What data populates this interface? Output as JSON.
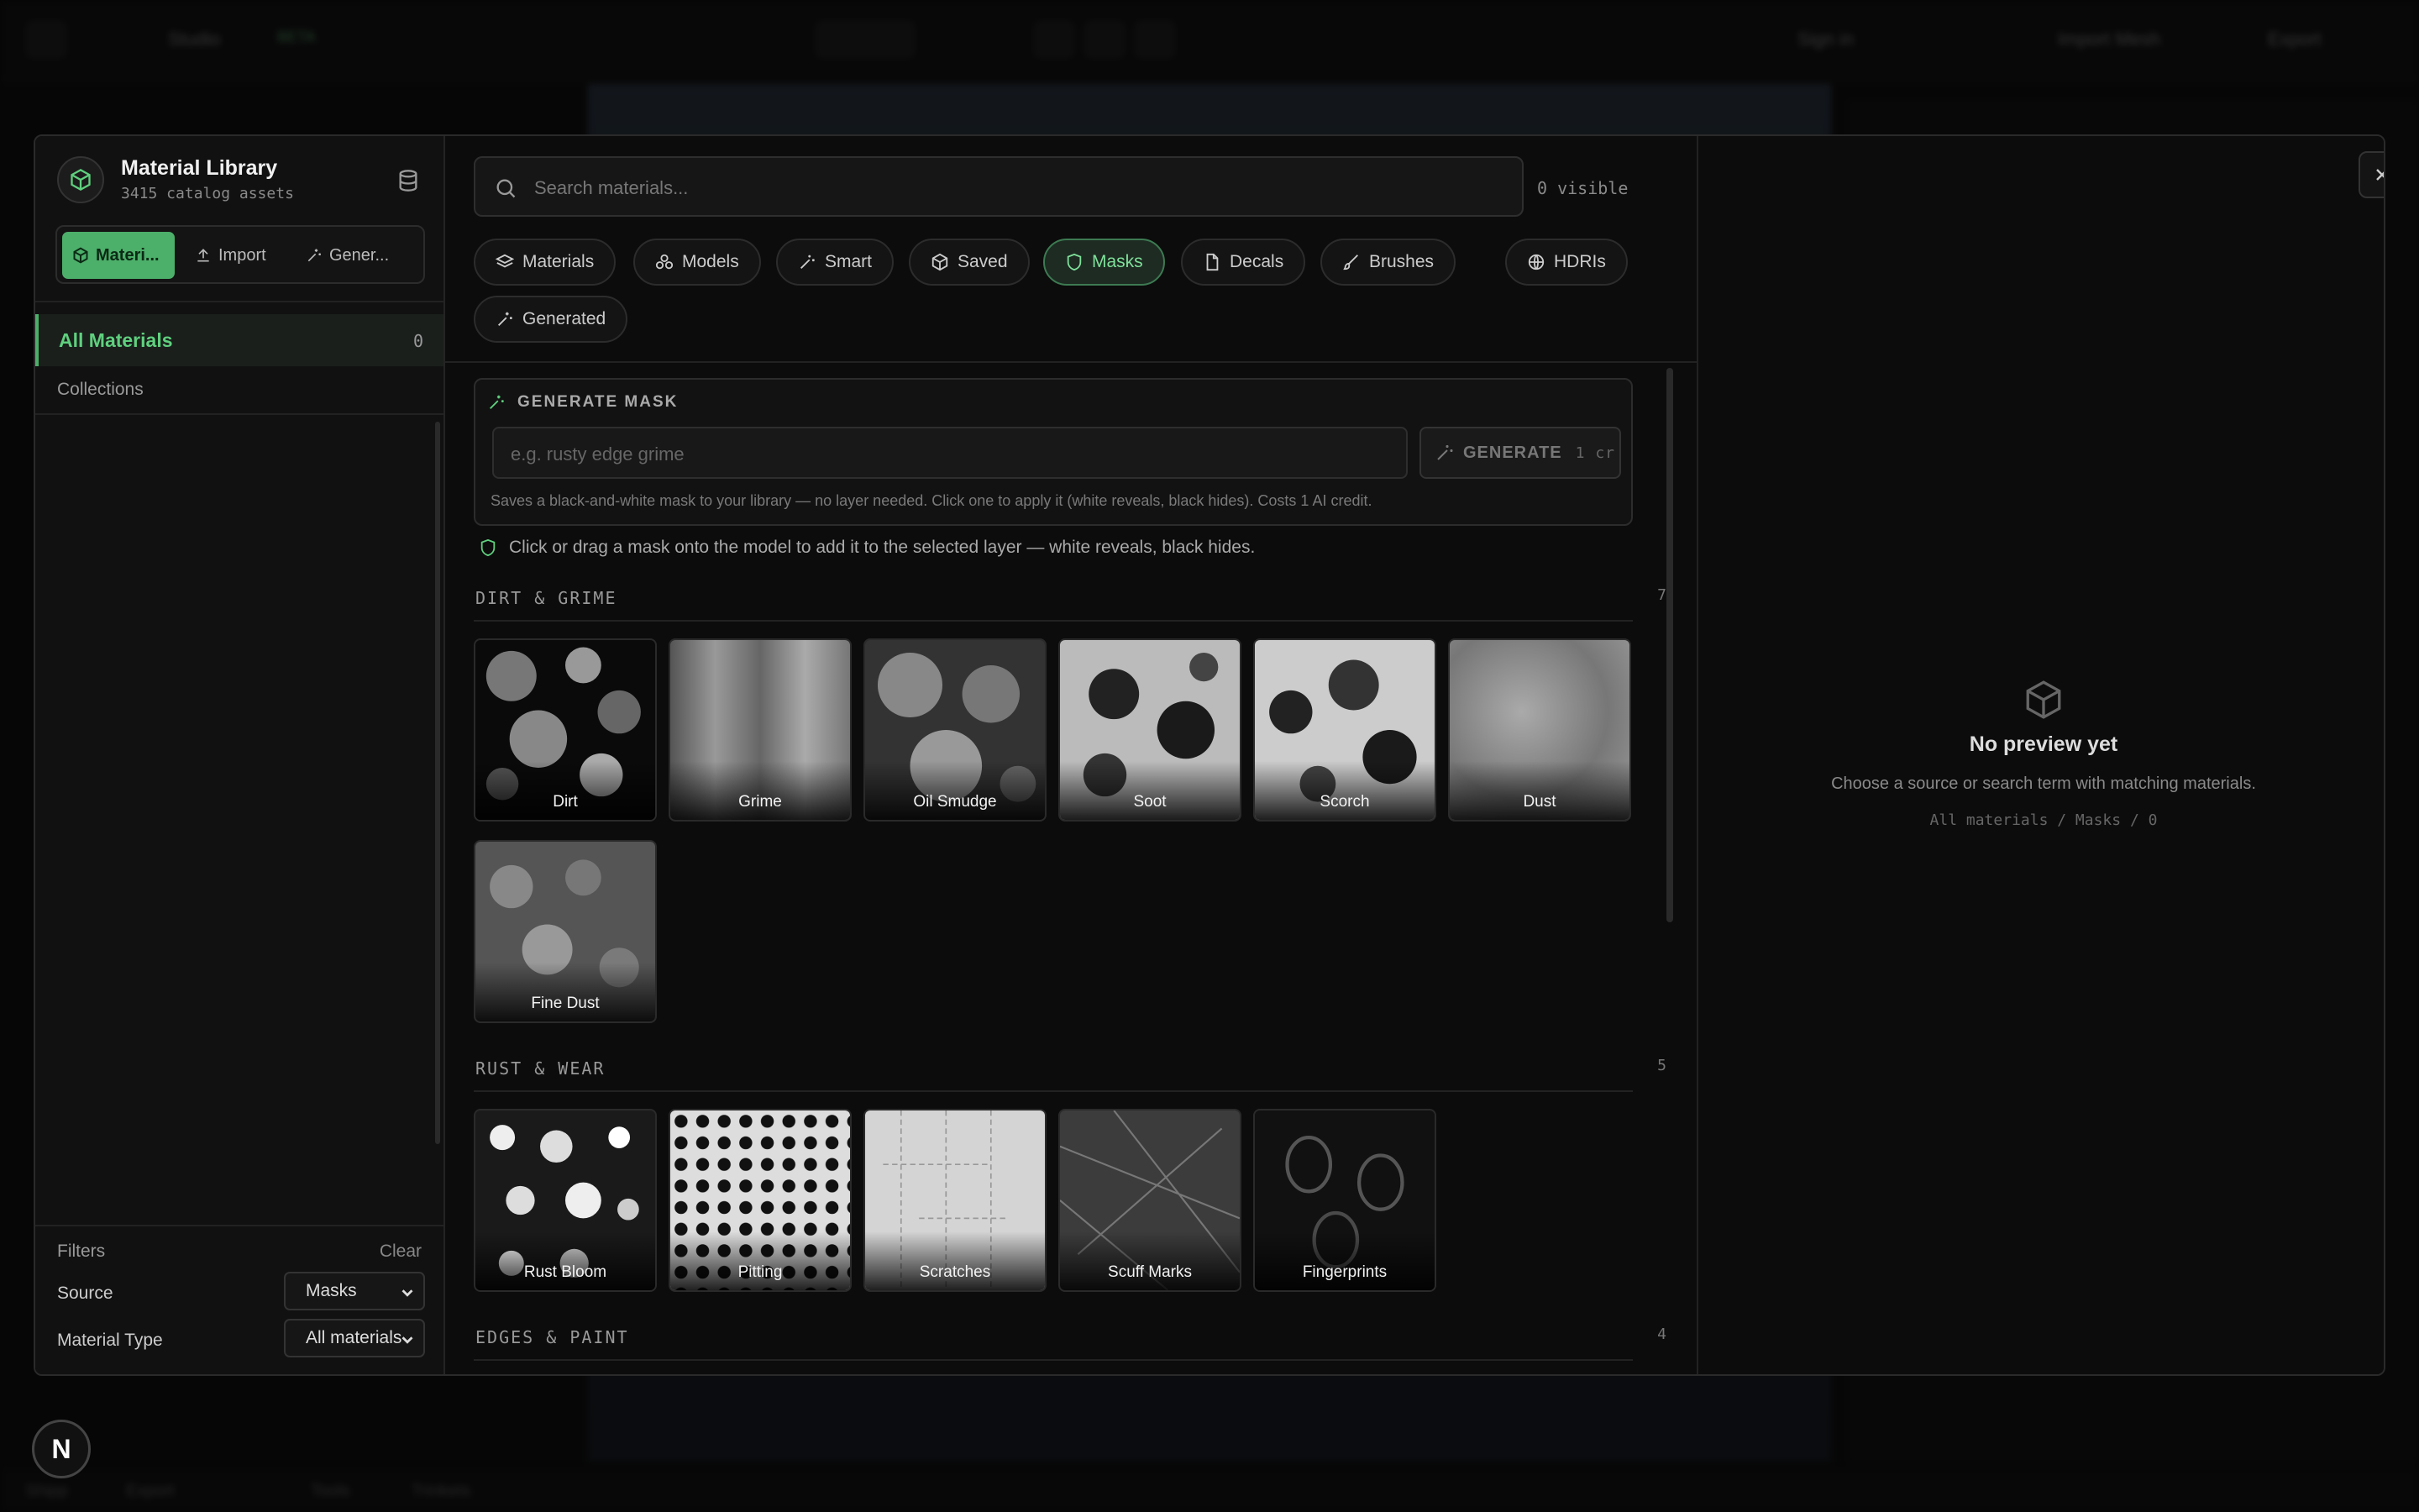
{
  "background": {
    "topbar_items": [
      "Studio",
      "BETA",
      "Sign in",
      "Import Mesh",
      "Export"
    ],
    "bottom_items": [
      "Shipp",
      "Export",
      "Tools",
      "Trinkets"
    ]
  },
  "library": {
    "title": "Material Library",
    "subtitle": "3415 catalog assets",
    "segments": [
      {
        "label": "Materi...",
        "icon": "cube-icon",
        "active": true
      },
      {
        "label": "Import",
        "icon": "upload-icon",
        "active": false
      },
      {
        "label": "Gener...",
        "icon": "sparkles-icon",
        "active": false
      }
    ],
    "all_materials": {
      "label": "All Materials",
      "count": "0"
    },
    "collections_label": "Collections",
    "filters": {
      "label": "Filters",
      "clear": "Clear",
      "source_label": "Source",
      "source_value": "Masks",
      "type_label": "Material Type",
      "type_value": "All materials"
    }
  },
  "search": {
    "placeholder": "Search materials...",
    "visible": "0 visible"
  },
  "tabs": [
    {
      "label": "Materials",
      "icon": "layers-icon"
    },
    {
      "label": "Models",
      "icon": "shapes-icon"
    },
    {
      "label": "Smart",
      "icon": "wand-icon"
    },
    {
      "label": "Saved",
      "icon": "box-icon"
    },
    {
      "label": "Masks",
      "icon": "shield-icon",
      "active": true
    },
    {
      "label": "Decals",
      "icon": "sticker-icon"
    },
    {
      "label": "Brushes",
      "icon": "brush-icon"
    },
    {
      "label": "HDRIs",
      "icon": "globe-icon"
    },
    {
      "label": "Generated",
      "icon": "sparkles-icon"
    }
  ],
  "generate": {
    "heading": "GENERATE MASK",
    "placeholder": "e.g. rusty edge grime",
    "button": "GENERATE",
    "cost": "1 cr",
    "note": "Saves a black-and-white mask to your library — no layer needed. Click one to apply it (white reveals, black hides). Costs 1 AI credit."
  },
  "hint": "Click or drag a mask onto the model to add it to the selected layer — white reveals, black hides.",
  "sections": [
    {
      "title": "DIRT & GRIME",
      "count": "7",
      "items": [
        "Dirt",
        "Grime",
        "Oil Smudge",
        "Soot",
        "Scorch",
        "Dust",
        "Fine Dust"
      ]
    },
    {
      "title": "RUST & WEAR",
      "count": "5",
      "items": [
        "Rust Bloom",
        "Pitting",
        "Scratches",
        "Scuff Marks",
        "Fingerprints"
      ]
    },
    {
      "title": "EDGES & PAINT",
      "count": "4",
      "items": []
    }
  ],
  "preview": {
    "title": "No preview yet",
    "subtitle": "Choose a source or search term with matching materials.",
    "path": "All materials / Masks / 0"
  },
  "badge": "N",
  "colors": {
    "accent": "#4caf6a",
    "accent_text": "#5fd07e"
  }
}
